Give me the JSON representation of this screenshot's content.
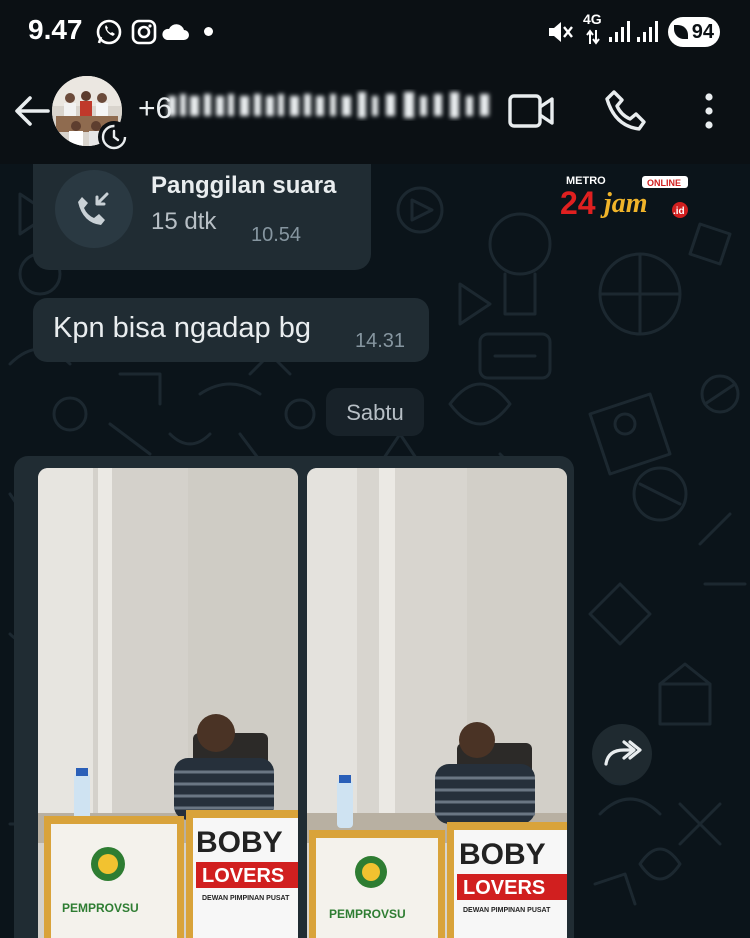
{
  "status_bar": {
    "time": "9.47",
    "network": "4G",
    "battery": "94",
    "icons": [
      "whatsapp-icon",
      "instagram-icon",
      "cloud-icon",
      "dot-icon",
      "mute-icon",
      "data-arrows-icon",
      "signal-icon",
      "signal-icon",
      "battery-icon"
    ]
  },
  "header": {
    "contact_name_prefix": "+6",
    "icons": [
      "back-arrow-icon",
      "video-call-icon",
      "voice-call-icon",
      "more-options-icon"
    ]
  },
  "messages": {
    "call": {
      "title": "Panggilan suara",
      "duration": "15 dtk",
      "time": "10.54",
      "icon": "incoming-call-icon"
    },
    "text": {
      "body": "Kpn bisa ngadap bg",
      "time": "14.31"
    },
    "date_separator": "Sabtu",
    "media": {
      "photo_1": {
        "left_sign": "PEMPROVSU",
        "right_sign_top": "BOBY",
        "right_sign_bottom": "LOVERS",
        "right_sign_caption": "DEWAN PIMPINAN PUSAT"
      },
      "photo_2": {
        "left_sign": "PEMPROVSU",
        "right_sign_top": "BOBY",
        "right_sign_bottom": "LOVERS",
        "right_sign_caption": "DEWAN PIMPINAN PUSAT"
      }
    }
  },
  "watermark": {
    "top": "METRO",
    "number": "24",
    "word": "jam",
    "badge": "ONLINE",
    "suffix": ".id"
  },
  "colors": {
    "background": "#0b141a",
    "bubble": "#202c33",
    "text": "#e9edef",
    "meta": "#8696a0"
  }
}
